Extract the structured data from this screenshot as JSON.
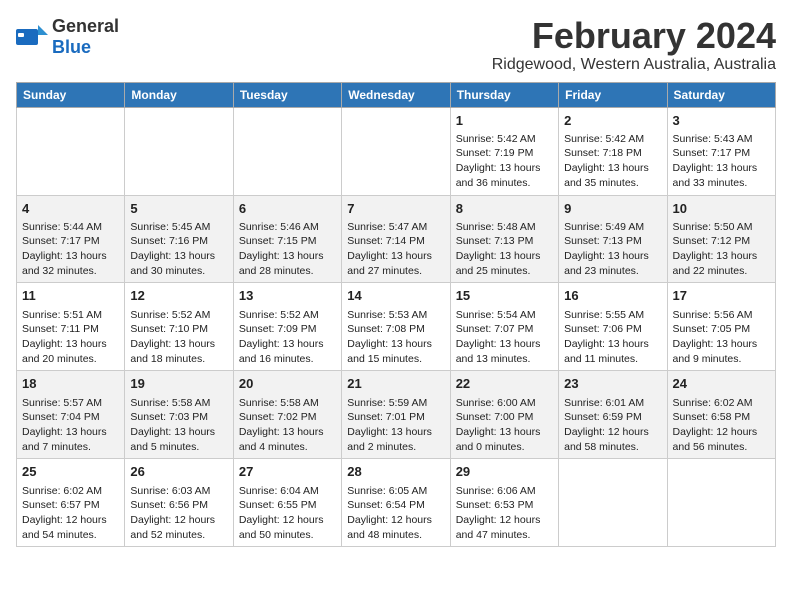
{
  "header": {
    "logo_general": "General",
    "logo_blue": "Blue",
    "title": "February 2024",
    "subtitle": "Ridgewood, Western Australia, Australia"
  },
  "days_of_week": [
    "Sunday",
    "Monday",
    "Tuesday",
    "Wednesday",
    "Thursday",
    "Friday",
    "Saturday"
  ],
  "weeks": [
    [
      {
        "day": "",
        "info": ""
      },
      {
        "day": "",
        "info": ""
      },
      {
        "day": "",
        "info": ""
      },
      {
        "day": "",
        "info": ""
      },
      {
        "day": "1",
        "info": "Sunrise: 5:42 AM\nSunset: 7:19 PM\nDaylight: 13 hours\nand 36 minutes."
      },
      {
        "day": "2",
        "info": "Sunrise: 5:42 AM\nSunset: 7:18 PM\nDaylight: 13 hours\nand 35 minutes."
      },
      {
        "day": "3",
        "info": "Sunrise: 5:43 AM\nSunset: 7:17 PM\nDaylight: 13 hours\nand 33 minutes."
      }
    ],
    [
      {
        "day": "4",
        "info": "Sunrise: 5:44 AM\nSunset: 7:17 PM\nDaylight: 13 hours\nand 32 minutes."
      },
      {
        "day": "5",
        "info": "Sunrise: 5:45 AM\nSunset: 7:16 PM\nDaylight: 13 hours\nand 30 minutes."
      },
      {
        "day": "6",
        "info": "Sunrise: 5:46 AM\nSunset: 7:15 PM\nDaylight: 13 hours\nand 28 minutes."
      },
      {
        "day": "7",
        "info": "Sunrise: 5:47 AM\nSunset: 7:14 PM\nDaylight: 13 hours\nand 27 minutes."
      },
      {
        "day": "8",
        "info": "Sunrise: 5:48 AM\nSunset: 7:13 PM\nDaylight: 13 hours\nand 25 minutes."
      },
      {
        "day": "9",
        "info": "Sunrise: 5:49 AM\nSunset: 7:13 PM\nDaylight: 13 hours\nand 23 minutes."
      },
      {
        "day": "10",
        "info": "Sunrise: 5:50 AM\nSunset: 7:12 PM\nDaylight: 13 hours\nand 22 minutes."
      }
    ],
    [
      {
        "day": "11",
        "info": "Sunrise: 5:51 AM\nSunset: 7:11 PM\nDaylight: 13 hours\nand 20 minutes."
      },
      {
        "day": "12",
        "info": "Sunrise: 5:52 AM\nSunset: 7:10 PM\nDaylight: 13 hours\nand 18 minutes."
      },
      {
        "day": "13",
        "info": "Sunrise: 5:52 AM\nSunset: 7:09 PM\nDaylight: 13 hours\nand 16 minutes."
      },
      {
        "day": "14",
        "info": "Sunrise: 5:53 AM\nSunset: 7:08 PM\nDaylight: 13 hours\nand 15 minutes."
      },
      {
        "day": "15",
        "info": "Sunrise: 5:54 AM\nSunset: 7:07 PM\nDaylight: 13 hours\nand 13 minutes."
      },
      {
        "day": "16",
        "info": "Sunrise: 5:55 AM\nSunset: 7:06 PM\nDaylight: 13 hours\nand 11 minutes."
      },
      {
        "day": "17",
        "info": "Sunrise: 5:56 AM\nSunset: 7:05 PM\nDaylight: 13 hours\nand 9 minutes."
      }
    ],
    [
      {
        "day": "18",
        "info": "Sunrise: 5:57 AM\nSunset: 7:04 PM\nDaylight: 13 hours\nand 7 minutes."
      },
      {
        "day": "19",
        "info": "Sunrise: 5:58 AM\nSunset: 7:03 PM\nDaylight: 13 hours\nand 5 minutes."
      },
      {
        "day": "20",
        "info": "Sunrise: 5:58 AM\nSunset: 7:02 PM\nDaylight: 13 hours\nand 4 minutes."
      },
      {
        "day": "21",
        "info": "Sunrise: 5:59 AM\nSunset: 7:01 PM\nDaylight: 13 hours\nand 2 minutes."
      },
      {
        "day": "22",
        "info": "Sunrise: 6:00 AM\nSunset: 7:00 PM\nDaylight: 13 hours\nand 0 minutes."
      },
      {
        "day": "23",
        "info": "Sunrise: 6:01 AM\nSunset: 6:59 PM\nDaylight: 12 hours\nand 58 minutes."
      },
      {
        "day": "24",
        "info": "Sunrise: 6:02 AM\nSunset: 6:58 PM\nDaylight: 12 hours\nand 56 minutes."
      }
    ],
    [
      {
        "day": "25",
        "info": "Sunrise: 6:02 AM\nSunset: 6:57 PM\nDaylight: 12 hours\nand 54 minutes."
      },
      {
        "day": "26",
        "info": "Sunrise: 6:03 AM\nSunset: 6:56 PM\nDaylight: 12 hours\nand 52 minutes."
      },
      {
        "day": "27",
        "info": "Sunrise: 6:04 AM\nSunset: 6:55 PM\nDaylight: 12 hours\nand 50 minutes."
      },
      {
        "day": "28",
        "info": "Sunrise: 6:05 AM\nSunset: 6:54 PM\nDaylight: 12 hours\nand 48 minutes."
      },
      {
        "day": "29",
        "info": "Sunrise: 6:06 AM\nSunset: 6:53 PM\nDaylight: 12 hours\nand 47 minutes."
      },
      {
        "day": "",
        "info": ""
      },
      {
        "day": "",
        "info": ""
      }
    ]
  ]
}
